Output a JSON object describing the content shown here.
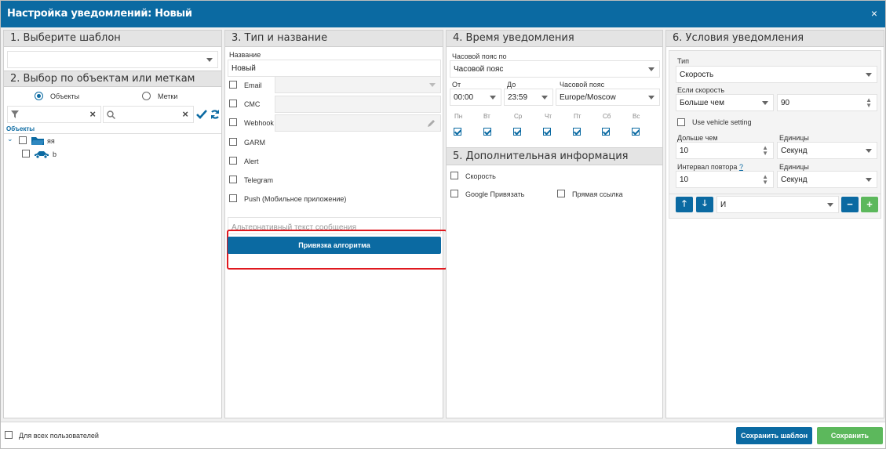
{
  "window": {
    "title": "Настройка уведомлений: Новый",
    "close_glyph": "×"
  },
  "template": {
    "header": "1. Выберите шаблон",
    "selected": ""
  },
  "objects": {
    "header": "2. Выбор по объектам или меткам",
    "radio_objects": "Объекты",
    "radio_tags": "Метки",
    "radio_selected": "objects",
    "filter_value": "",
    "search_value": "",
    "tree_header": "Объекты",
    "tree": [
      {
        "label": "яя",
        "icon": "folder-icon",
        "expanded": true
      },
      {
        "label": "b",
        "icon": "car-icon"
      }
    ]
  },
  "type": {
    "header": "3. Тип и название",
    "name_label": "Название",
    "name_value": "Новый",
    "channels": [
      {
        "label": "Email",
        "checked": false
      },
      {
        "label": "СМС",
        "checked": false
      },
      {
        "label": "Webhook",
        "checked": false
      },
      {
        "label": "GARM",
        "checked": false
      },
      {
        "label": "Alert",
        "checked": false
      },
      {
        "label": "Telegram",
        "checked": false
      },
      {
        "label": "Push (Мобильное приложение)",
        "checked": false
      }
    ],
    "alt_text_placeholder": "Альтернативный текст сообщения",
    "algorithm_button": "Привязка алгоритма"
  },
  "time": {
    "header": "4. Время уведомления",
    "tz_by_label": "Часовой пояс по",
    "tz_by_value": "Часовой пояс",
    "from_label": "От",
    "from_value": "00:00",
    "to_label": "До",
    "to_value": "23:59",
    "tz_label": "Часовой пояс",
    "tz_value": "Europe/Moscow",
    "days": [
      {
        "label": "Пн",
        "checked": true
      },
      {
        "label": "Вт",
        "checked": true
      },
      {
        "label": "Ср",
        "checked": true
      },
      {
        "label": "Чт",
        "checked": true
      },
      {
        "label": "Пт",
        "checked": true
      },
      {
        "label": "Сб",
        "checked": true
      },
      {
        "label": "Вс",
        "checked": true
      }
    ]
  },
  "extra": {
    "header": "5. Дополнительная информация",
    "speed": "Скорость",
    "google": "Google Привязать",
    "direct_link": "Прямая ссылка"
  },
  "conditions": {
    "header": "6. Условия уведомления",
    "type_label": "Тип",
    "type_value": "Скорость",
    "if_speed_label": "Если скорость",
    "compare_value": "Больше чем",
    "speed_value": "90",
    "vehicle_setting": "Use vehicle setting",
    "longer_label": "Дольше чем",
    "longer_value": "10",
    "units_label": "Единицы",
    "units_value": "Секунд",
    "repeat_label": "Интервал повтора",
    "repeat_help": "?",
    "repeat_value": "10",
    "units2_label": "Единицы",
    "units2_value": "Секунд",
    "logic_value": "И",
    "up_glyph": "🡑",
    "down_glyph": "🡓",
    "minus_glyph": "−",
    "plus_glyph": "+"
  },
  "footer": {
    "all_users": "Для всех пользователей",
    "save_template": "Сохранить шаблон",
    "save": "Сохранить"
  },
  "colors": {
    "primary": "#0b6aa2",
    "green": "#5cb85c",
    "highlight": "#e0191f"
  }
}
